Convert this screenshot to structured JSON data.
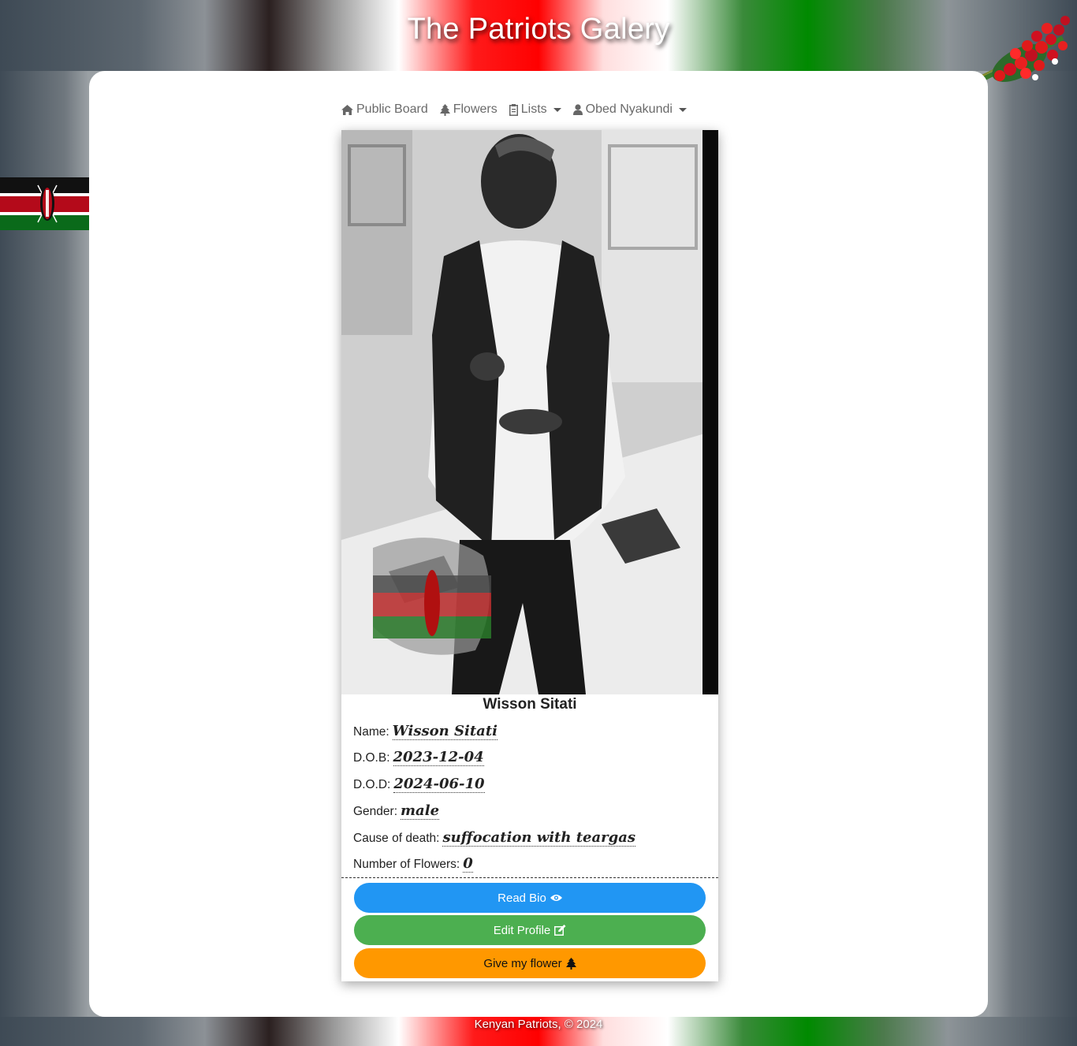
{
  "header": {
    "title": "The Patriots Galery"
  },
  "nav": {
    "items": [
      {
        "label": "Public Board",
        "icon": "home-icon"
      },
      {
        "label": "Flowers",
        "icon": "tree-icon"
      },
      {
        "label": "Lists",
        "icon": "clipboard-icon",
        "dropdown": true
      },
      {
        "label": "Obed Nyakundi",
        "icon": "user-icon",
        "dropdown": true
      }
    ]
  },
  "card": {
    "title": "Wisson Sitati",
    "fields": [
      {
        "label": "Name:",
        "value": "Wisson Sitati"
      },
      {
        "label": "D.O.B:",
        "value": "2023-12-04"
      },
      {
        "label": "D.O.D:",
        "value": "2024-06-10"
      },
      {
        "label": "Gender:",
        "value": "male"
      },
      {
        "label": "Cause of death:",
        "value": "suffocation with teargas"
      },
      {
        "label": "Number of Flowers:",
        "value": "0"
      }
    ],
    "buttons": {
      "read_bio": "Read Bio",
      "edit_profile": "Edit Profile",
      "give_flower": "Give my flower"
    }
  },
  "footer": {
    "text": "Kenyan Patriots, © 2024"
  },
  "colors": {
    "read_bio": "#2196f3",
    "edit_profile": "#4caf50",
    "give_flower": "#ff9800"
  }
}
